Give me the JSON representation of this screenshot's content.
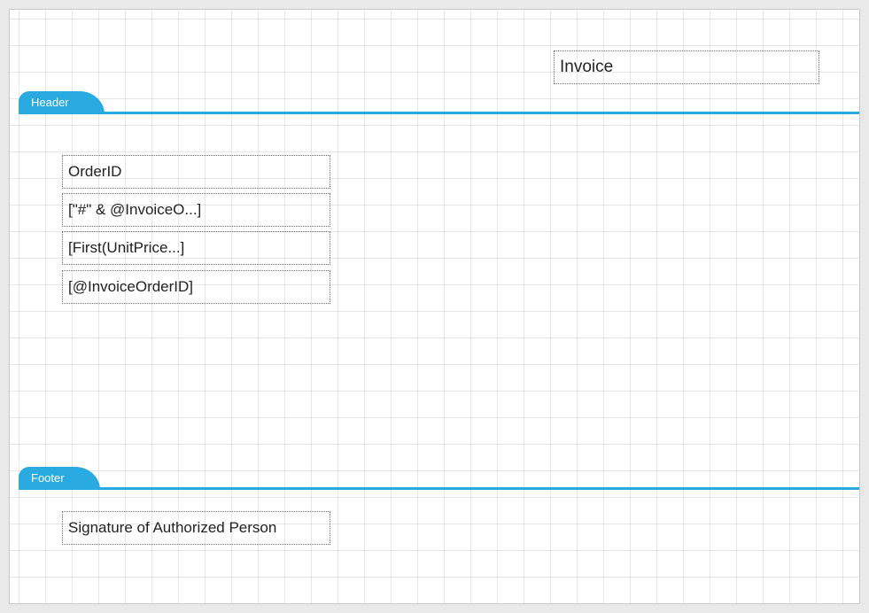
{
  "regions": {
    "header_label": "Header",
    "footer_label": "Footer"
  },
  "top_region": {
    "invoice_title": "Invoice"
  },
  "header_region": {
    "order_id_label": "OrderID",
    "expr_invoice_order": "[\"#\" & @InvoiceO...]",
    "expr_first_unitprice": "[First(UnitPrice...]",
    "expr_invoice_order_id": "[@InvoiceOrderID]"
  },
  "footer_region": {
    "signature_label": "Signature of Authorized Person"
  }
}
